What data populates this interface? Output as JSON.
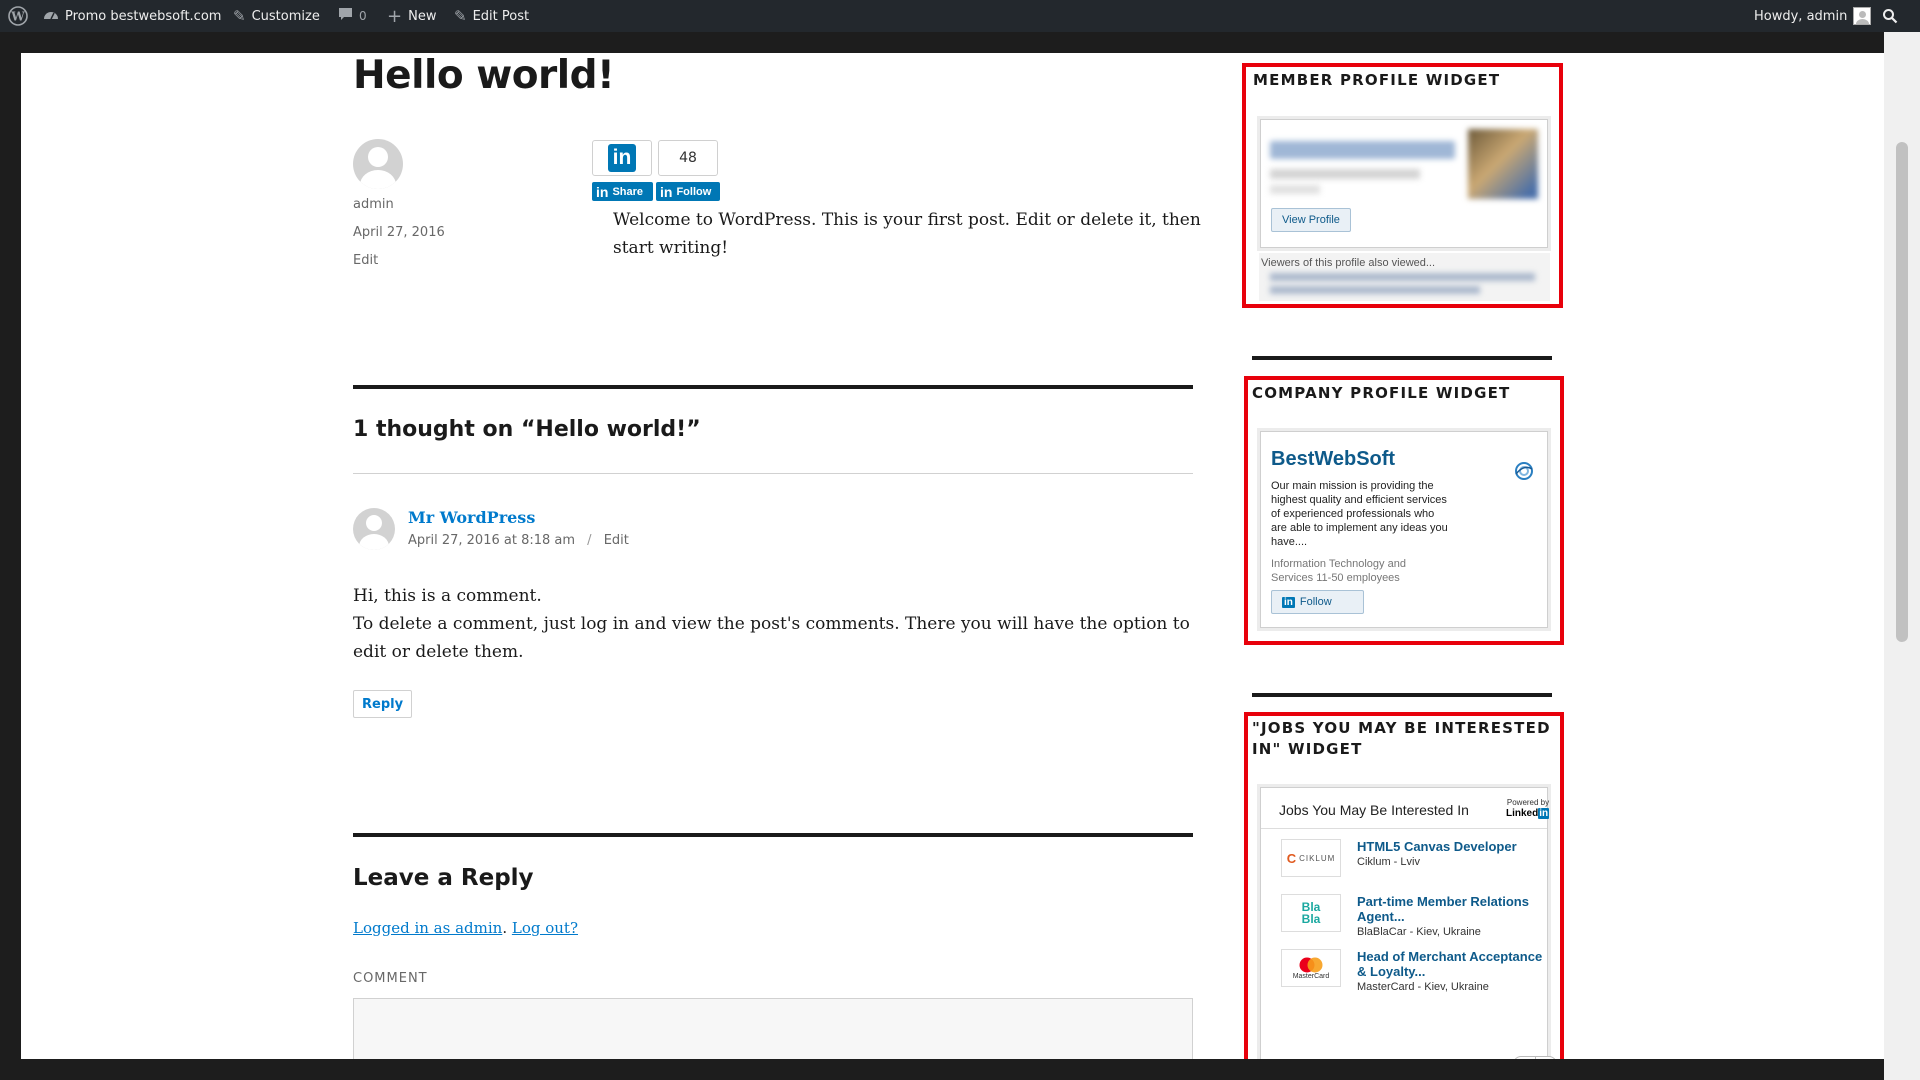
{
  "adminbar": {
    "site_name": "Promo bestwebsoft.com",
    "customize": "Customize",
    "comments_count": "0",
    "new_label": "New",
    "edit_post": "Edit Post",
    "howdy": "Howdy, admin"
  },
  "post": {
    "title": "Hello world!",
    "author": "admin",
    "date": "April 27, 2016",
    "edit": "Edit",
    "share_count": "48",
    "share_label": "Share",
    "follow_label": "Follow",
    "content": "Welcome to WordPress. This is your first post. Edit or delete it, then start writing!"
  },
  "comments": {
    "heading": "1 thought on “Hello world!”",
    "items": [
      {
        "author": "Mr WordPress",
        "date": "April 27, 2016 at 8:18 am",
        "separator": "/",
        "edit": "Edit",
        "line1": "Hi, this is a comment.",
        "line2": "To delete a comment, just log in and view the post's comments. There you will have the option to edit or delete them.",
        "reply": "Reply"
      }
    ]
  },
  "reply_form": {
    "heading": "Leave a Reply",
    "logged_in": "Logged in as admin",
    "separator": ".",
    "log_out": "Log out?",
    "comment_label": "COMMENT"
  },
  "sidebar": {
    "member_widget": {
      "title": "MEMBER PROFILE WIDGET",
      "view_profile": "View Profile",
      "also_viewed": "Viewers of this profile also viewed..."
    },
    "company_widget": {
      "title": "COMPANY PROFILE WIDGET",
      "name": "BestWebSoft",
      "description": "Our main mission is providing the highest quality and efficient services of experienced professionals who are able to implement any ideas you have....",
      "industry": "Information Technology and Services 11-50 employees",
      "follow": "Follow"
    },
    "jobs_widget": {
      "title": "\"JOBS YOU MAY BE INTERESTED IN\" WIDGET",
      "header": "Jobs You May Be Interested In",
      "powered_by": "Powered by",
      "brand": "Linked",
      "brand_in": "in",
      "jobs": [
        {
          "logo": "CIKLUM",
          "title": "HTML5 Canvas Developer",
          "company": "Ciklum - Lviv"
        },
        {
          "logo": "Bla Bla",
          "title": "Part-time Member Relations Agent...",
          "company": "BlaBlaCar - Kiev, Ukraine"
        },
        {
          "logo": "MasterCard",
          "title": "Head of Merchant Acceptance & Loyalty...",
          "company": "MasterCard - Kiev, Ukraine"
        }
      ]
    }
  },
  "icons": {
    "wp": "wordpress-logo-icon",
    "site": "dashboard-icon",
    "customize": "brush-icon",
    "comments": "comment-bubble-icon",
    "new": "plus-icon",
    "edit": "pencil-icon",
    "search": "search-icon"
  },
  "colors": {
    "admin_bar": "#23282d",
    "link": "#007acc",
    "linkedin": "#0077b5",
    "highlight": "#e8000b"
  }
}
